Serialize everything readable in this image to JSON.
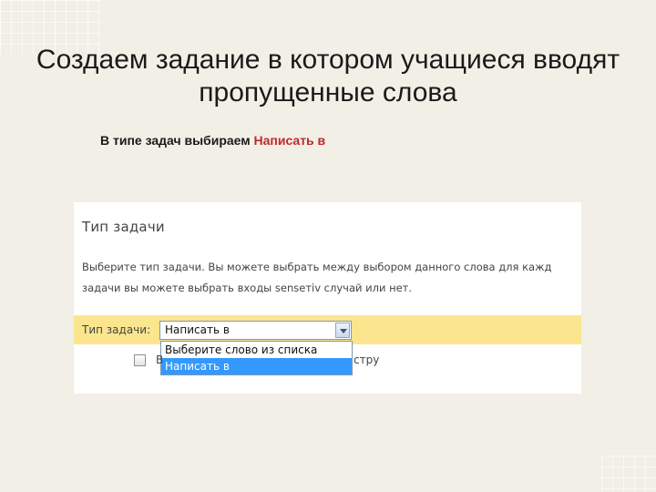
{
  "slide": {
    "title_line1": "Создаем задание в котором учащиеся вводят",
    "title_line2": "пропущенные слова",
    "instruction_prefix": "В типе задач выбираем ",
    "instruction_highlight": "Написать в",
    "highlight_color": "#c0282c"
  },
  "panel": {
    "heading": "Тип задачи",
    "description_line1": "Выберите тип задачи. Вы можете выбрать между выбором данного слова для кажд",
    "description_line2": "задачи вы можете выбрать входы senseтiv случай или нет.",
    "field_label": "Тип задачи:",
    "select_value": "Написать в",
    "options": [
      {
        "label": "Выберите слово из списка",
        "selected": false
      },
      {
        "label": "Написать в",
        "selected": true
      }
    ],
    "checkbox_text_start": "В",
    "checkbox_text_end": "стру",
    "checkbox_checked": false,
    "row_highlight_color": "#fbe58e",
    "option_selected_color": "#3399ff"
  }
}
